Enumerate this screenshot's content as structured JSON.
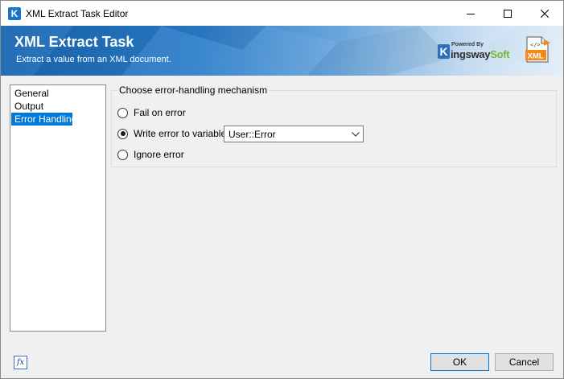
{
  "window": {
    "title": "XML Extract Task Editor",
    "icon_letter": "K",
    "controls": [
      "minimize-icon",
      "maximize-icon",
      "close-icon"
    ]
  },
  "banner": {
    "title": "XML Extract Task",
    "subtitle": "Extract a value from an XML document.",
    "logo": {
      "powered_by": "Powered By",
      "k_letter": "K",
      "name_part1": "ingsway",
      "name_part2": "Soft"
    },
    "icon_label": "XML",
    "icon_code": "</>"
  },
  "nav": {
    "items": [
      {
        "label": "General",
        "selected": false
      },
      {
        "label": "Output",
        "selected": false
      },
      {
        "label": "Error Handling",
        "selected": true
      }
    ]
  },
  "error_handling": {
    "group_label": "Choose error-handling mechanism",
    "options": [
      {
        "label": "Fail on error",
        "checked": false
      },
      {
        "label": "Write error to variable",
        "checked": true
      },
      {
        "label": "Ignore error",
        "checked": false
      }
    ],
    "variable": {
      "selected": "User::Error"
    }
  },
  "footer": {
    "fx_label": "fx",
    "ok_label": "OK",
    "cancel_label": "Cancel"
  },
  "colors": {
    "accent": "#0078d7",
    "banner_dark": "#1866b0",
    "logo_green": "#7ab534",
    "xml_orange": "#f28a1e"
  }
}
